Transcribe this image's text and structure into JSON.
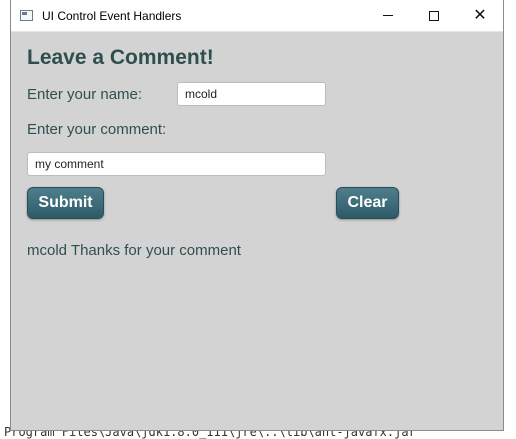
{
  "window": {
    "title": "UI Control Event Handlers"
  },
  "form": {
    "heading": "Leave a Comment!",
    "name_label": "Enter your name:",
    "name_value": "mcold",
    "comment_label": "Enter your comment:",
    "comment_value": "my comment",
    "submit_label": "Submit",
    "clear_label": "Clear",
    "message": "mcold Thanks for your comment"
  },
  "background": {
    "status_line": "Program Files\\Java\\jdk1.8.0_111\\jre\\..\\lib\\ant-javafx.jar"
  }
}
